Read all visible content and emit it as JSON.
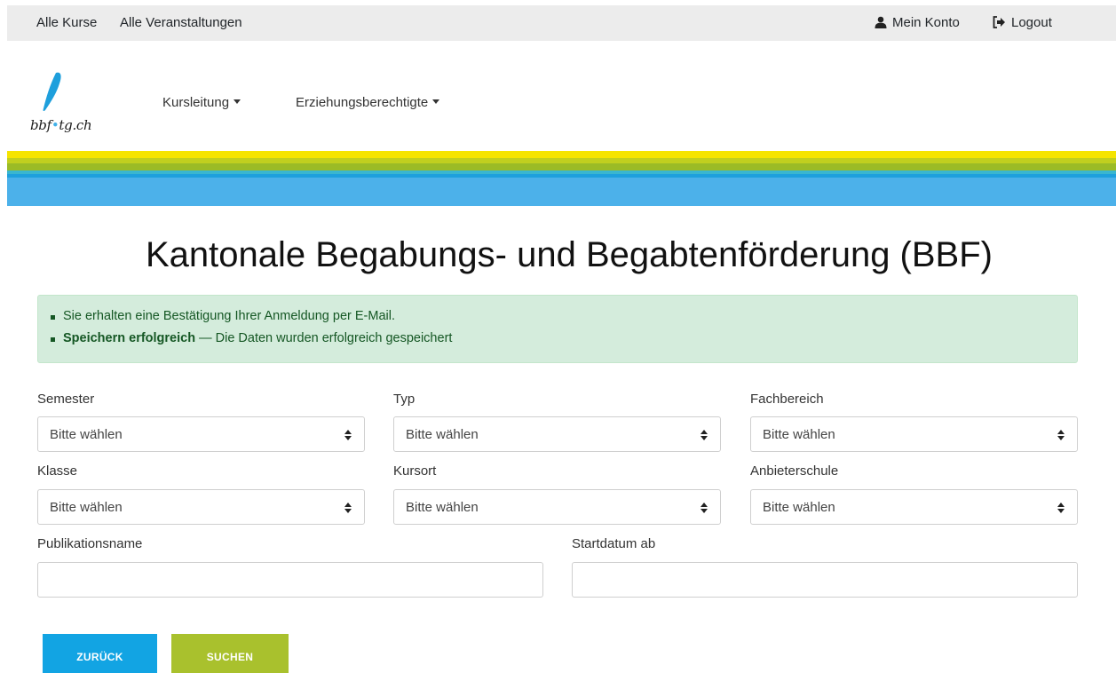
{
  "topbar": {
    "all_courses": "Alle Kurse",
    "all_events": "Alle Veranstaltungen",
    "my_account": "Mein Konto",
    "logout": "Logout"
  },
  "logo": {
    "text_before": "bbf",
    "text_after": "tg.ch"
  },
  "main_nav": {
    "kursleitung": "Kursleitung",
    "erziehungsberechtigte": "Erziehungsberechtigte"
  },
  "page": {
    "title": "Kantonale Begabungs- und Begabtenförderung (BBF)"
  },
  "alert": {
    "line1": "Sie erhalten eine Bestätigung Ihrer Anmeldung per E-Mail.",
    "line2_bold": "Speichern erfolgreich",
    "line2_rest": " — Die Daten wurden erfolgreich gespeichert"
  },
  "filters": {
    "semester": {
      "label": "Semester",
      "value": "Bitte wählen"
    },
    "typ": {
      "label": "Typ",
      "value": "Bitte wählen"
    },
    "fachbereich": {
      "label": "Fachbereich",
      "value": "Bitte wählen"
    },
    "klasse": {
      "label": "Klasse",
      "value": "Bitte wählen"
    },
    "kursort": {
      "label": "Kursort",
      "value": "Bitte wählen"
    },
    "anbieterschule": {
      "label": "Anbieterschule",
      "value": "Bitte wählen"
    },
    "publikationsname": {
      "label": "Publikationsname",
      "value": ""
    },
    "startdatum": {
      "label": "Startdatum ab",
      "value": ""
    }
  },
  "buttons": {
    "back": "Zurück",
    "search": "Suchen"
  },
  "colors": {
    "topbar_bg": "#ececec",
    "alert_bg": "#d4ecdc",
    "alert_text": "#155724",
    "stripe_yellow": "#f5e400",
    "stripe_green": "#9bbb26",
    "stripe_blue": "#4cb1ea",
    "button_back": "#12a4e3",
    "button_search": "#a9c12d"
  },
  "icons": {
    "account": "user-icon",
    "logout": "sign-out-icon",
    "select_arrow": "sort-arrows-icon"
  }
}
